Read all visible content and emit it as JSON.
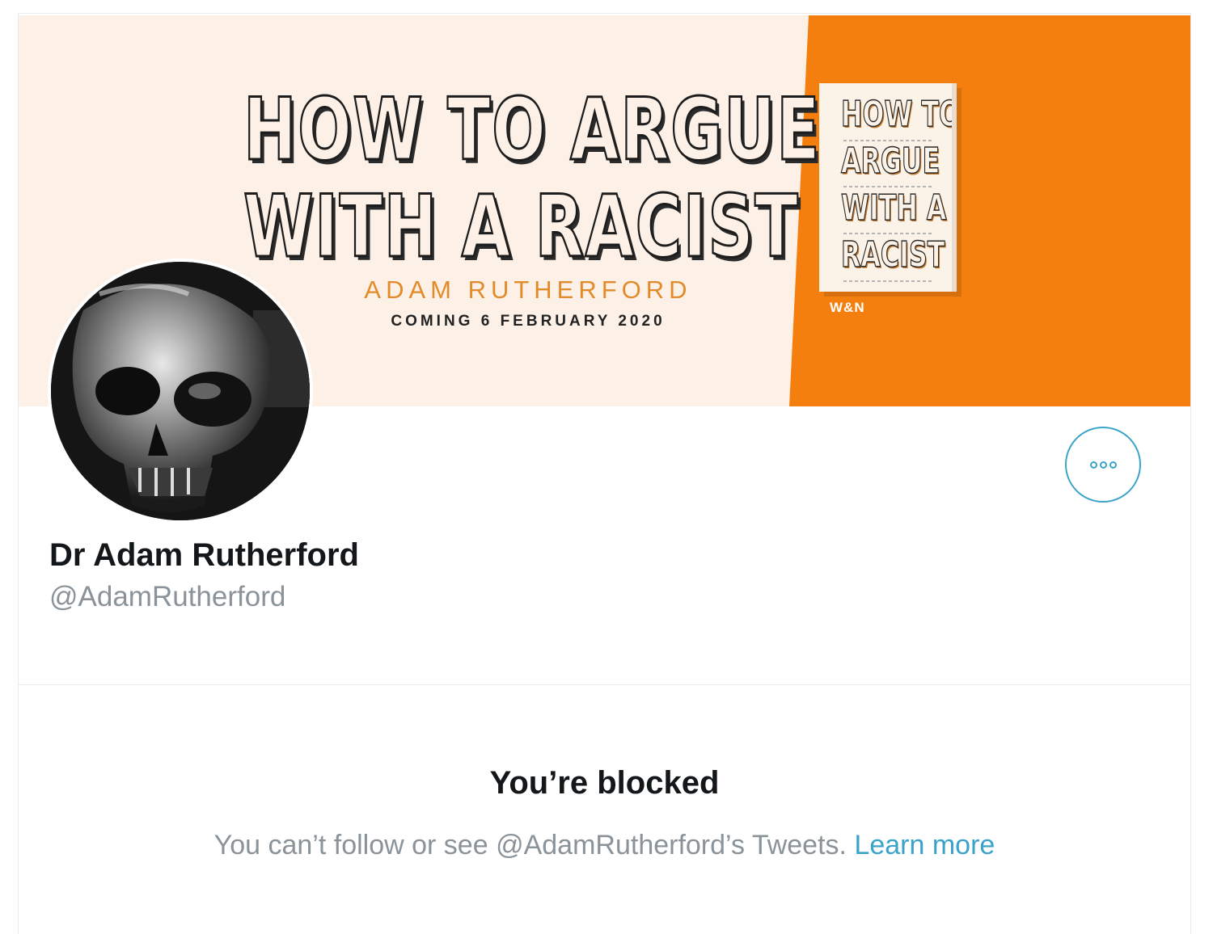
{
  "banner": {
    "title_line1": "HOW TO ARGUE",
    "title_line2": "WITH A RACIST",
    "author": "ADAM RUTHERFORD",
    "date": "COMING 6 FEBRUARY 2020",
    "book_line1": "HOW TO",
    "book_line2": "ARGUE",
    "book_line3": "WITH A",
    "book_line4": "RACIST",
    "publisher": "W&N",
    "colors": {
      "background": "#fdf1e7",
      "accent": "#f47f0f"
    }
  },
  "profile": {
    "display_name": "Dr Adam Rutherford",
    "handle": "@AdamRutherford",
    "avatar": "skull-avatar-icon",
    "more_icon": "more-options-icon"
  },
  "blocked": {
    "title": "You’re blocked",
    "message": "You can’t follow or see @AdamRutherford’s Tweets.",
    "link": "Learn more",
    "link_color": "#3aa3c9"
  }
}
